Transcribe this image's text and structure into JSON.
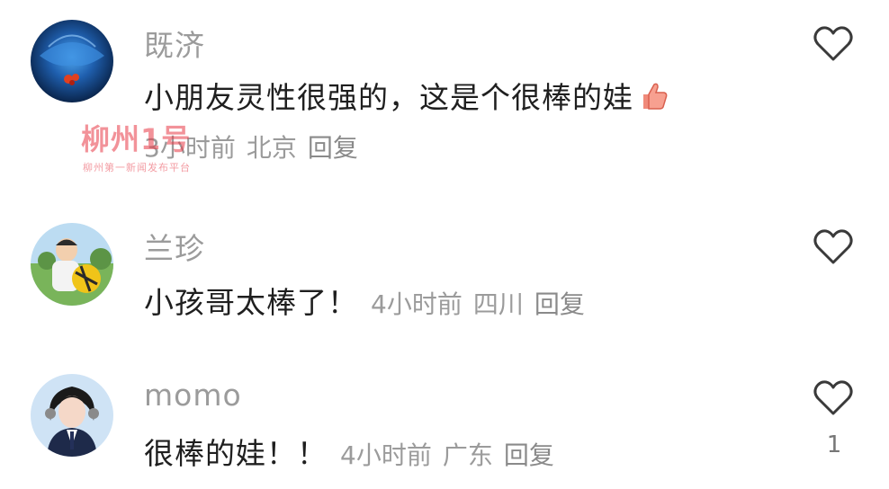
{
  "comments": [
    {
      "username": "既济",
      "text": "小朋友灵性很强的，这是个很棒的娃",
      "emoji": "thumbs-up",
      "time": "3小时前",
      "location": "北京",
      "reply": "回复",
      "likes": ""
    },
    {
      "username": "兰珍",
      "text": "小孩哥太棒了！",
      "time": "4小时前",
      "location": "四川",
      "reply": "回复",
      "likes": ""
    },
    {
      "username": "momo",
      "text": "很棒的娃！！",
      "time": "4小时前",
      "location": "广东",
      "reply": "回复",
      "likes": "1"
    }
  ],
  "watermark": {
    "title": "柳州1号",
    "subtitle": "柳州第一新闻发布平台"
  },
  "colors": {
    "username": "#9b9b9b",
    "content": "#1f1f1f",
    "meta": "#9b9b9b",
    "watermark": "#e83846"
  }
}
